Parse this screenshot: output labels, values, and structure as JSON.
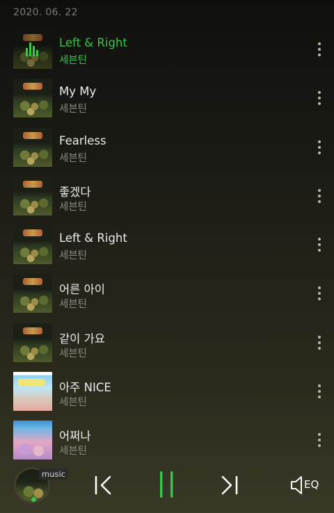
{
  "header": {
    "date": "2020. 06. 22"
  },
  "tracks": [
    {
      "title": "Left & Right",
      "artist": "세븐틴",
      "art": "dark",
      "playing": true
    },
    {
      "title": "My My",
      "artist": "세븐틴",
      "art": "dark",
      "playing": false
    },
    {
      "title": "Fearless",
      "artist": "세븐틴",
      "art": "dark",
      "playing": false
    },
    {
      "title": "좋겠다",
      "artist": "세븐틴",
      "art": "dark",
      "playing": false
    },
    {
      "title": "Left & Right",
      "artist": "세븐틴",
      "art": "dark",
      "playing": false
    },
    {
      "title": "어른 아이",
      "artist": "세븐틴",
      "art": "dark",
      "playing": false
    },
    {
      "title": "같이 가요",
      "artist": "세븐틴",
      "art": "dark",
      "playing": false
    },
    {
      "title": "아주 NICE",
      "artist": "세븐틴",
      "art": "blue",
      "playing": false
    },
    {
      "title": "어쩌나",
      "artist": "세븐틴",
      "art": "pink",
      "playing": false
    }
  ],
  "player": {
    "badge": "music",
    "eq_label": "EQ",
    "state": "playing"
  },
  "colors": {
    "accent": "#34c64a",
    "text": "#ececec",
    "subtext": "#8b8b85"
  }
}
